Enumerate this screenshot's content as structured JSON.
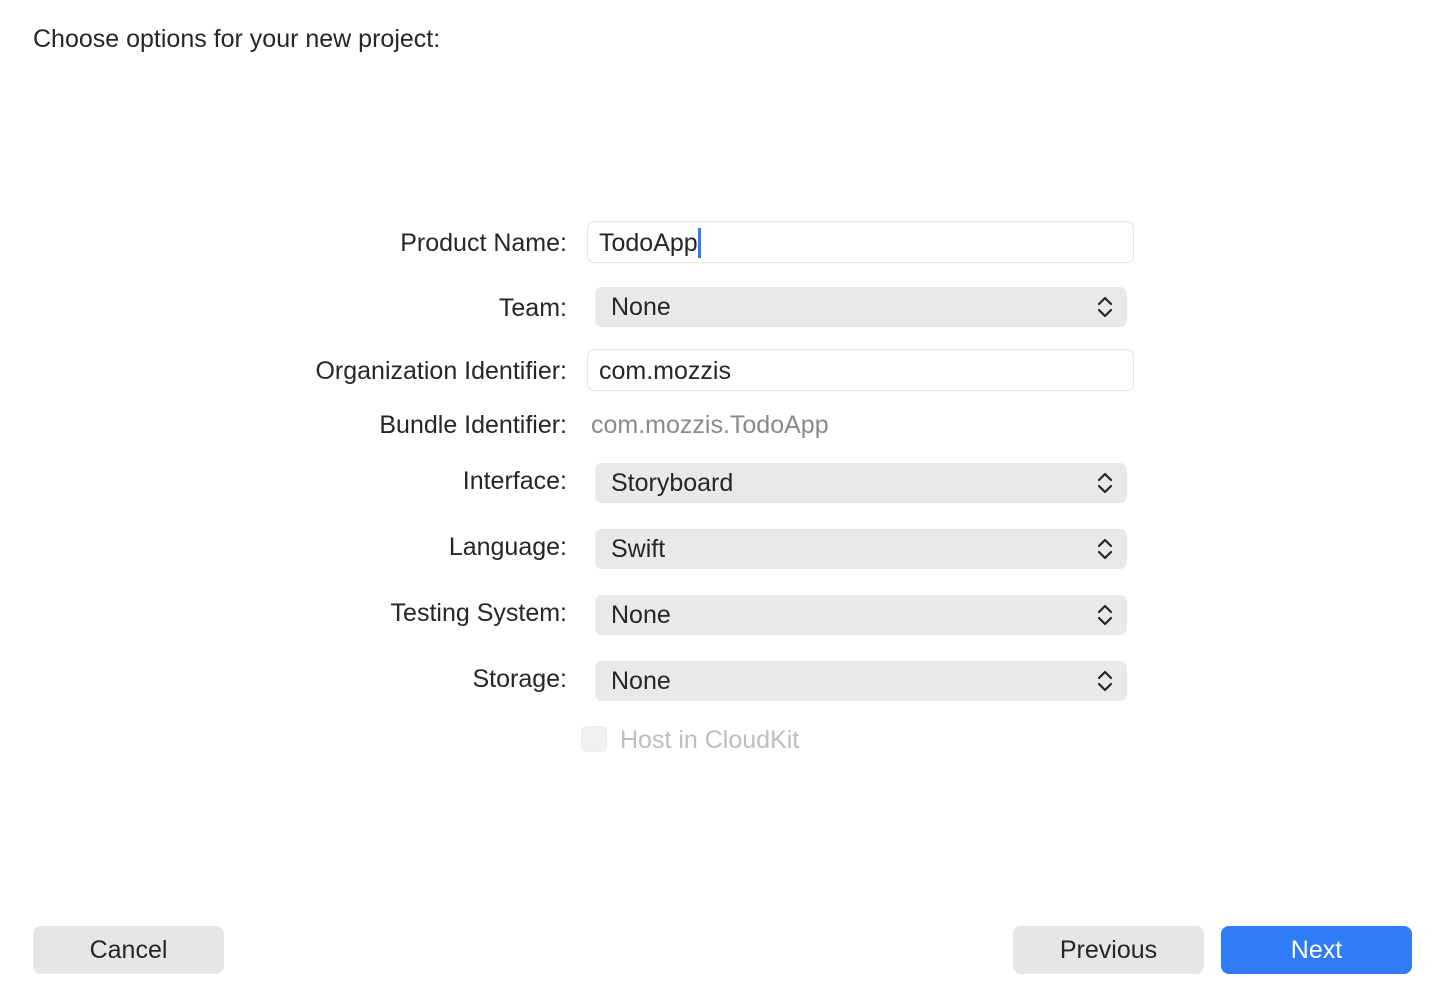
{
  "dialog": {
    "title": "Choose options for your new project:"
  },
  "form": {
    "product_name": {
      "label": "Product Name:",
      "value": "TodoApp"
    },
    "team": {
      "label": "Team:",
      "selected": "None",
      "icon": "up-down-chevron-icon"
    },
    "organization_identifier": {
      "label": "Organization Identifier:",
      "value": "com.mozzis"
    },
    "bundle_identifier": {
      "label": "Bundle Identifier:",
      "value": "com.mozzis.TodoApp"
    },
    "interface": {
      "label": "Interface:",
      "selected": "Storyboard",
      "icon": "up-down-chevron-icon"
    },
    "language": {
      "label": "Language:",
      "selected": "Swift",
      "icon": "up-down-chevron-icon"
    },
    "testing_system": {
      "label": "Testing System:",
      "selected": "None",
      "icon": "up-down-chevron-icon"
    },
    "storage": {
      "label": "Storage:",
      "selected": "None",
      "icon": "up-down-chevron-icon"
    },
    "host_in_cloudkit": {
      "label": "Host in CloudKit",
      "checked": false,
      "enabled": false
    }
  },
  "footer": {
    "cancel_label": "Cancel",
    "previous_label": "Previous",
    "next_label": "Next"
  },
  "colors": {
    "accent": "#2f7cf6",
    "popup_bg": "#e9e9e9",
    "button_bg": "#e6e6e6",
    "text": "#262626",
    "secondary_text": "#8a8a8a",
    "disabled_text": "#bdbdbd"
  }
}
